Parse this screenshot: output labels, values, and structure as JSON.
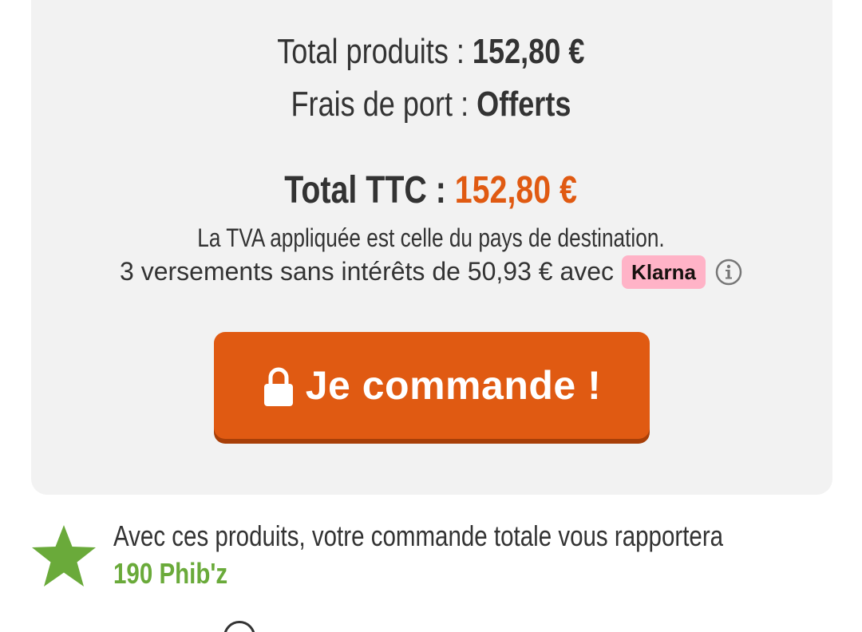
{
  "summary": {
    "products_label": "Total produits : ",
    "products_value": "152,80 €",
    "shipping_label": "Frais de port : ",
    "shipping_value": "Offerts",
    "total_label": "Total TTC : ",
    "total_value": "152,80 €",
    "vat_note": "La TVA appliquée est celle du pays de destination.",
    "installments_text": "3 versements sans intérêts de 50,93 € avec",
    "klarna_label": "Klarna"
  },
  "order_button": {
    "label": "Je commande !"
  },
  "rewards": {
    "text": "Avec ces produits, votre commande totale vous rapportera",
    "points": "190 Phib'z"
  },
  "colors": {
    "accent": "#e05a12",
    "card_background": "#f2f2f2",
    "klarna_pink": "#ffb3c7",
    "reward_green": "#6aaa3a"
  },
  "icons": [
    "info-icon",
    "lock-icon",
    "star-icon"
  ]
}
